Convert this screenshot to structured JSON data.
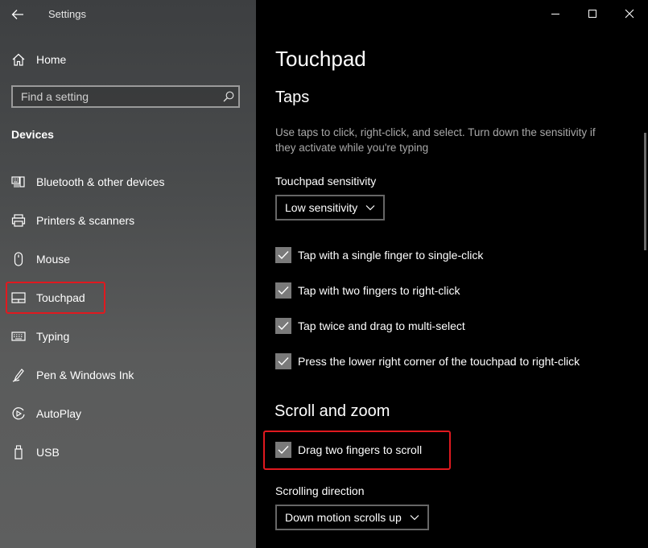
{
  "window": {
    "title": "Settings"
  },
  "sidebar": {
    "home_label": "Home",
    "search_placeholder": "Find a setting",
    "section_title": "Devices",
    "items": [
      {
        "label": "Bluetooth & other devices",
        "icon": "bluetooth-device-icon"
      },
      {
        "label": "Printers & scanners",
        "icon": "printer-icon"
      },
      {
        "label": "Mouse",
        "icon": "mouse-icon"
      },
      {
        "label": "Touchpad",
        "icon": "touchpad-icon",
        "selected": true
      },
      {
        "label": "Typing",
        "icon": "keyboard-icon"
      },
      {
        "label": "Pen & Windows Ink",
        "icon": "pen-icon"
      },
      {
        "label": "AutoPlay",
        "icon": "autoplay-icon"
      },
      {
        "label": "USB",
        "icon": "usb-icon"
      }
    ]
  },
  "main": {
    "page_title": "Touchpad",
    "taps": {
      "heading": "Taps",
      "description": "Use taps to click, right-click, and select. Turn down the sensitivity if they activate while you're typing",
      "sensitivity_label": "Touchpad sensitivity",
      "sensitivity_value": "Low sensitivity",
      "options": [
        {
          "label": "Tap with a single finger to single-click",
          "checked": true
        },
        {
          "label": "Tap with two fingers to right-click",
          "checked": true
        },
        {
          "label": "Tap twice and drag to multi-select",
          "checked": true
        },
        {
          "label": "Press the lower right corner of the touchpad to right-click",
          "checked": true
        }
      ]
    },
    "scroll_zoom": {
      "heading": "Scroll and zoom",
      "drag_scroll_label": "Drag two fingers to scroll",
      "drag_scroll_checked": true,
      "direction_label": "Scrolling direction",
      "direction_value": "Down motion scrolls up"
    }
  },
  "colors": {
    "highlight": "#e0191f",
    "checkbox_fill": "#7a7a7a",
    "main_background": "#000000"
  }
}
